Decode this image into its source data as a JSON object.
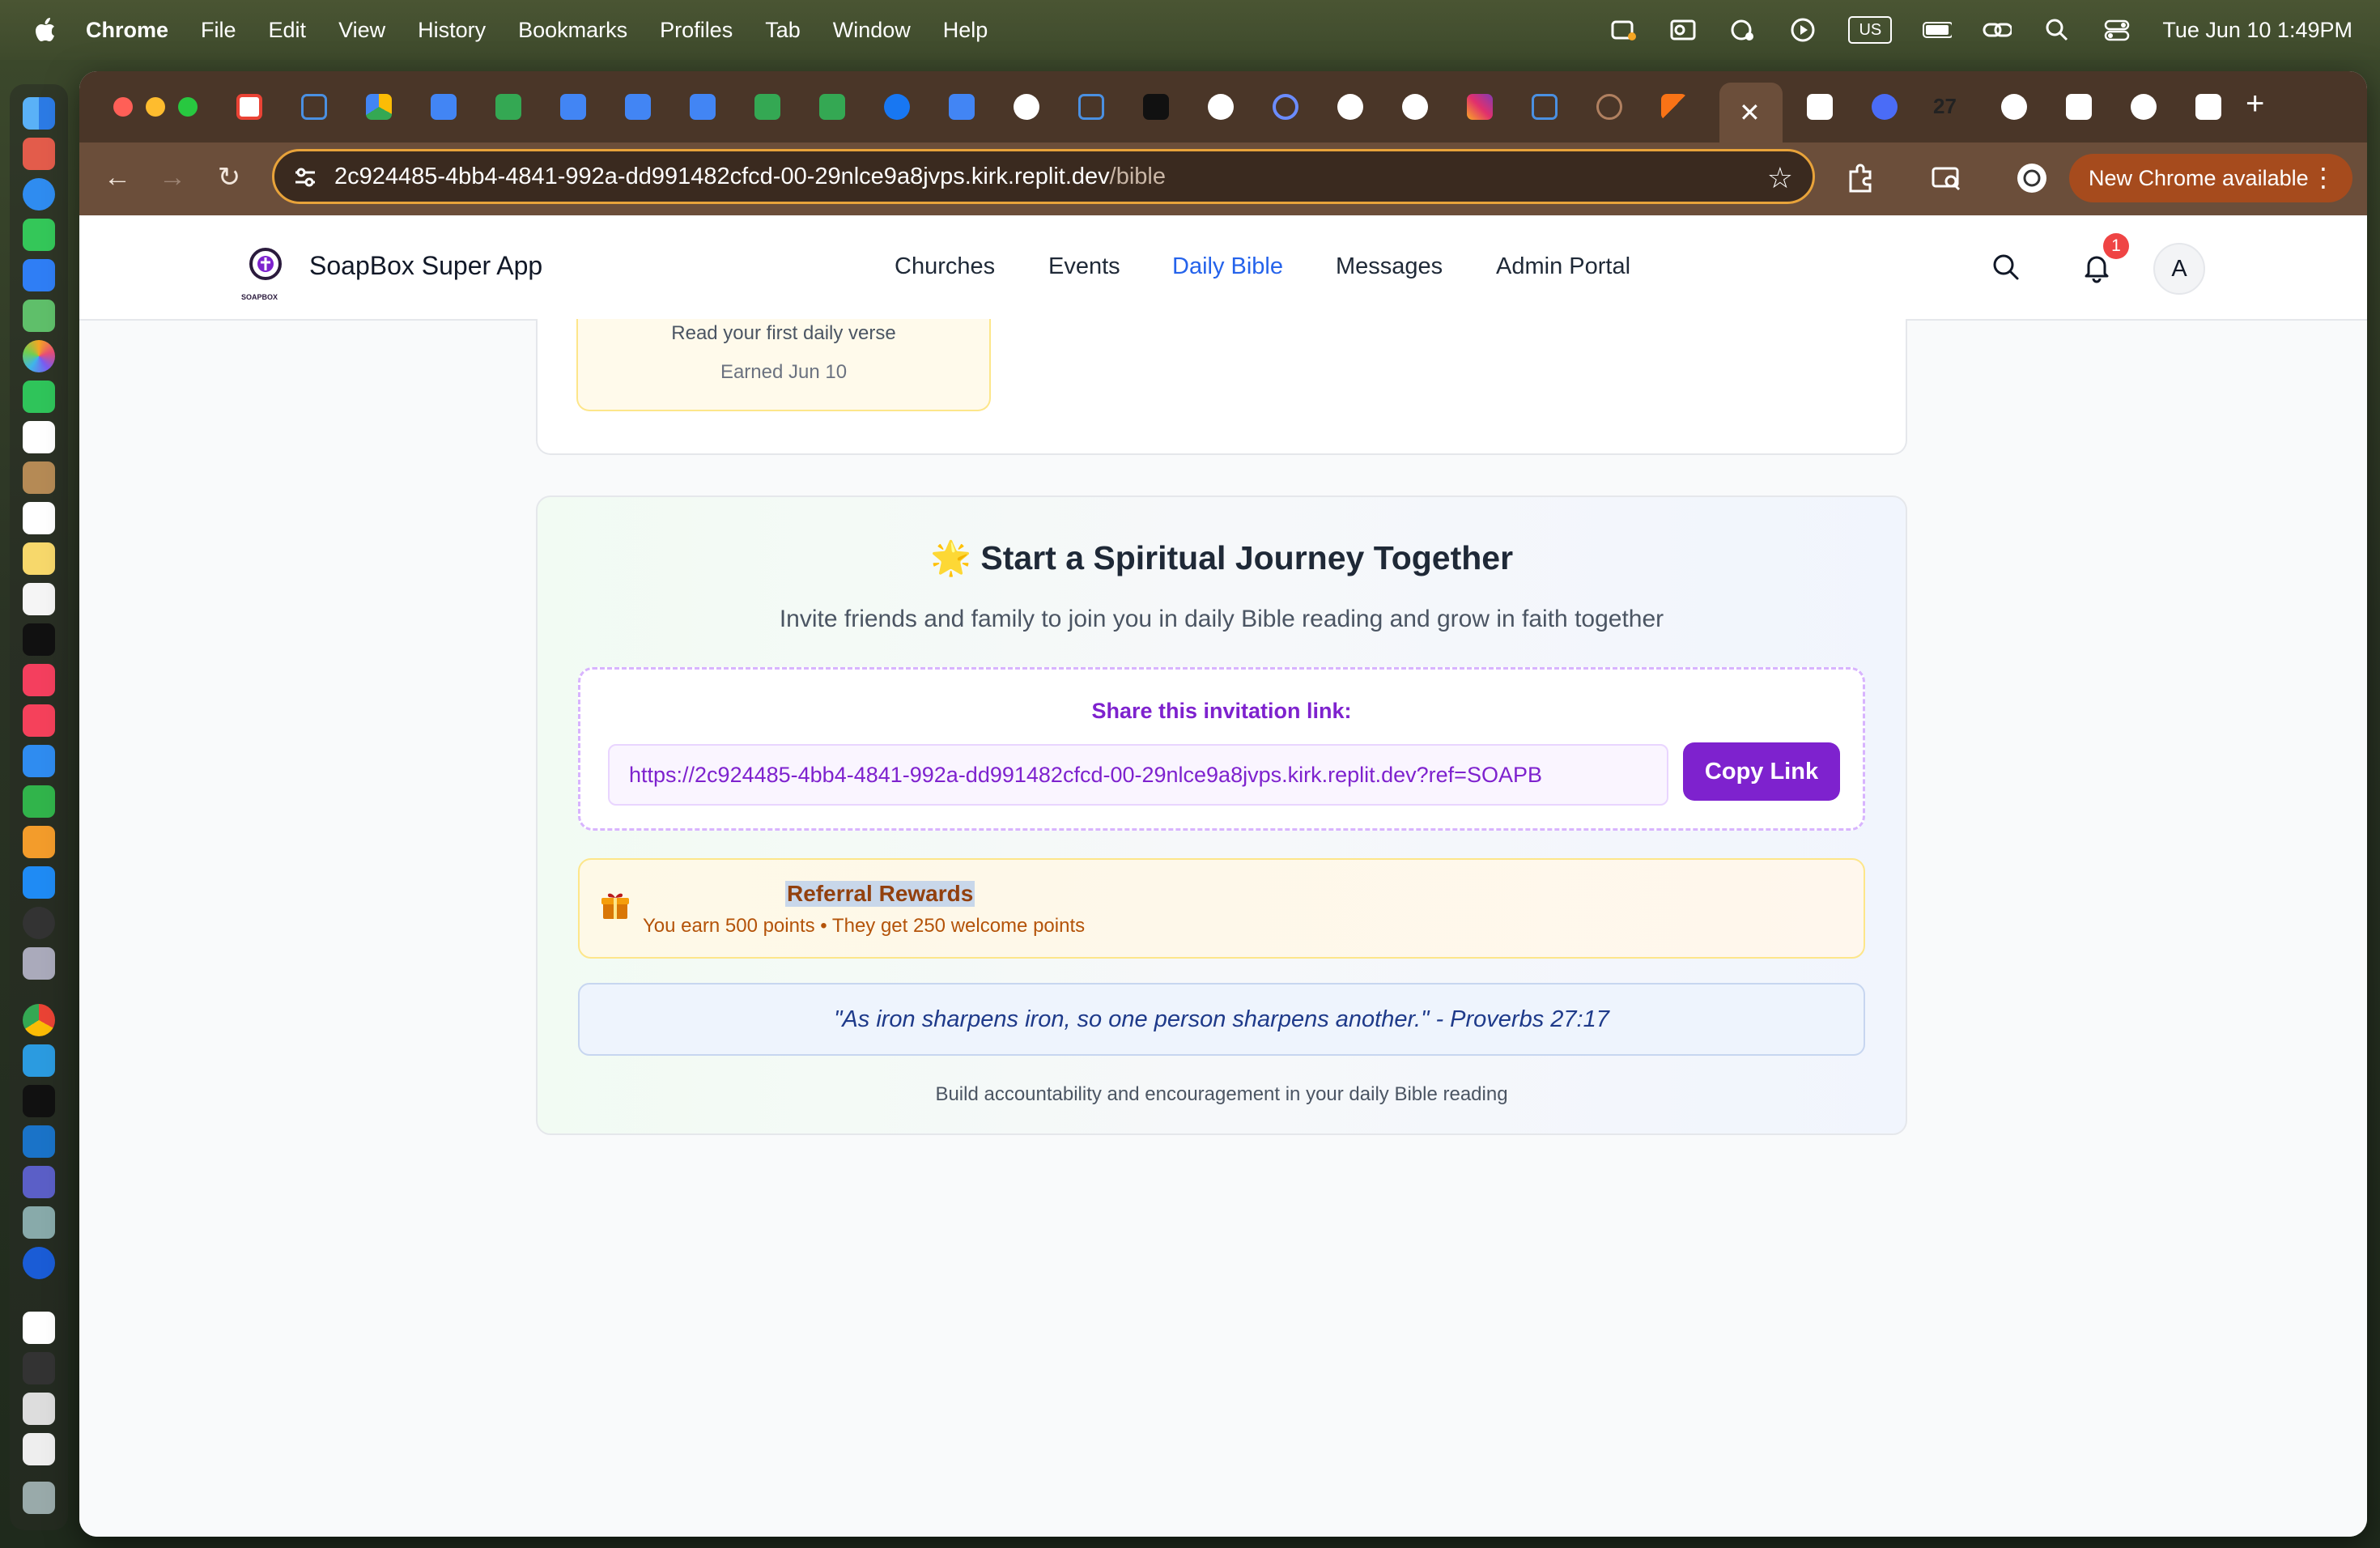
{
  "menubar": {
    "app_name": "Chrome",
    "items": [
      "File",
      "Edit",
      "View",
      "History",
      "Bookmarks",
      "Profiles",
      "Tab",
      "Window",
      "Help"
    ],
    "input_source": "US",
    "clock": "Tue Jun 10  1:49PM"
  },
  "browser": {
    "url_host": "2c924485-4bb4-4841-992a-dd991482cfcd-00-29nlce9a8jvps.kirk.replit.dev",
    "url_path": "/bible",
    "update_label": "New Chrome available",
    "active_tab_close": "✕",
    "tab_badge": "27",
    "new_tab": "+"
  },
  "app": {
    "title": "SoapBox Super App",
    "logo_text": "SOAPBOX",
    "nav": {
      "churches": "Churches",
      "events": "Events",
      "daily_bible": "Daily Bible",
      "messages": "Messages",
      "admin_portal": "Admin Portal"
    },
    "active_nav": "Daily Bible",
    "notification_count": "1",
    "avatar_initial": "A"
  },
  "achievement": {
    "description": "Read your first daily verse",
    "earned": "Earned Jun 10"
  },
  "journey": {
    "emoji": "🌟",
    "title": "Start a Spiritual Journey Together",
    "subtitle": "Invite friends and family to join you in daily Bible reading and grow in faith together",
    "share_label": "Share this invitation link:",
    "share_link": "https://2c924485-4bb4-4841-992a-dd991482cfcd-00-29nlce9a8jvps.kirk.replit.dev?ref=SOAPB",
    "copy_button": "Copy Link",
    "rewards_title": "Referral Rewards",
    "rewards_desc": "You earn 500 points • They get 250 welcome points",
    "verse": "\"As iron sharpens iron, so one person sharpens another.\" - Proverbs 27:17",
    "footnote": "Build accountability and encouragement in your daily Bible reading"
  },
  "colors": {
    "accent_purple": "#7e22ce",
    "nav_active": "#2563eb",
    "badge_red": "#ef4444",
    "chrome_frame": "#6b4e3a"
  }
}
